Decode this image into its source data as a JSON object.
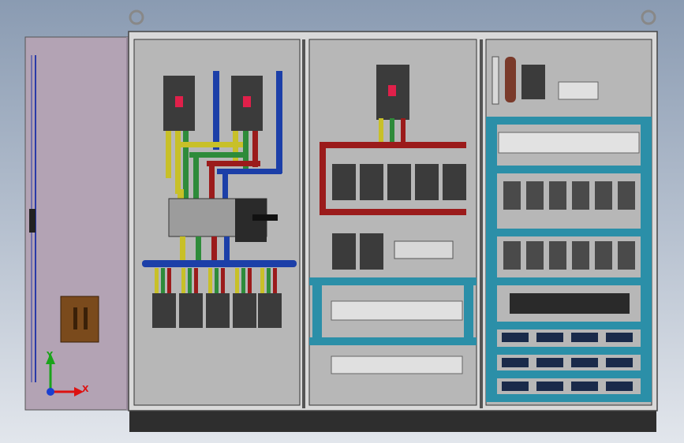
{
  "scene": {
    "description_visible_text": "",
    "axis_triad": {
      "x_label": "X",
      "y_label": "Y"
    },
    "colors": {
      "background_top": "#8a9bb2",
      "background_bottom": "#e2e6ec",
      "cabinet_frame": "#d9d9d9",
      "panel_plate": "#b5b5b5",
      "door_panel": "#b0a0b2",
      "busbar_red": "#9b1b1b",
      "busbar_yellow": "#c8c028",
      "busbar_green": "#2e8b3a",
      "busbar_blue": "#1c3fa8",
      "din_rail_teal": "#2b8fa8",
      "breaker_body": "#3b3b3b",
      "breaker_handle": "#e0204a",
      "plinth": "#2e2e2e",
      "handle_brown": "#7a4a1c"
    }
  }
}
